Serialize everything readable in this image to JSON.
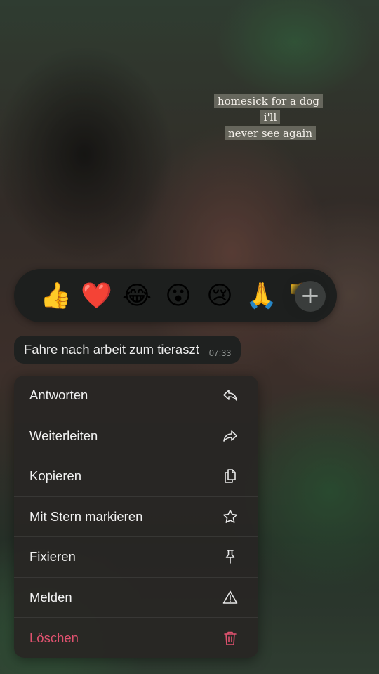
{
  "story_caption": {
    "line1": "homesick for a dog i'll",
    "line2": "never see again"
  },
  "reactions": {
    "items": [
      {
        "emoji": "👍",
        "name": "thumbs-up"
      },
      {
        "emoji": "❤️",
        "name": "red-heart"
      },
      {
        "emoji": "😂",
        "name": "tears-of-joy"
      },
      {
        "emoji": "😮",
        "name": "open-mouth"
      },
      {
        "emoji": "😢",
        "name": "crying-face"
      },
      {
        "emoji": "🙏",
        "name": "folded-hands"
      },
      {
        "emoji": "👎",
        "name": "thumbs-down"
      }
    ],
    "more_symbol": "+"
  },
  "message": {
    "text": "Fahre nach arbeit zum tieraszt",
    "time": "07:33"
  },
  "menu": {
    "items": [
      {
        "label": "Antworten",
        "icon": "reply-icon"
      },
      {
        "label": "Weiterleiten",
        "icon": "forward-icon"
      },
      {
        "label": "Kopieren",
        "icon": "copy-icon"
      },
      {
        "label": "Mit Stern markieren",
        "icon": "star-icon"
      },
      {
        "label": "Fixieren",
        "icon": "pin-icon"
      },
      {
        "label": "Melden",
        "icon": "warning-icon"
      },
      {
        "label": "Löschen",
        "icon": "trash-icon"
      }
    ]
  },
  "colors": {
    "danger": "#e0526f",
    "menu_bg": "#282624",
    "bubble_bg": "#1f2120",
    "reaction_bar_bg": "#1d1f1e"
  }
}
